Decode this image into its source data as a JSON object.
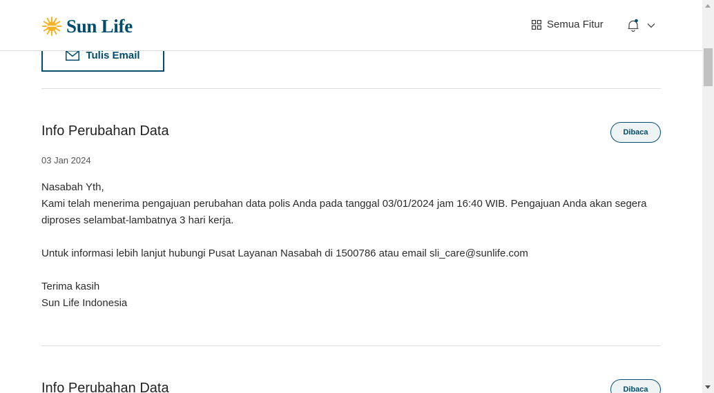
{
  "header": {
    "brand": "Sun Life",
    "features_label": "Semua Fitur",
    "icons": {
      "logo": "sun-logo",
      "features": "grid-icon",
      "notifications": "bell-icon",
      "menu": "chevron-down-icon"
    },
    "colors": {
      "brand": "#004c6c",
      "logo_sun": "#f5b324"
    }
  },
  "actions": {
    "write_email_label": "Tulis Email",
    "write_email_icon": "mail-icon"
  },
  "messages": [
    {
      "title": "Info Perubahan Data",
      "status": "Dibaca",
      "date": "03 Jan 2024",
      "greeting": "Nasabah Yth,",
      "body_line1": "Kami telah menerima pengajuan perubahan data polis Anda pada tanggal 03/01/2024 jam 16:40 WIB. Pengajuan Anda akan segera diproses selambat-lambatnya 3 hari kerja.",
      "body_line2": "Untuk informasi lebih lanjut hubungi Pusat Layanan Nasabah di 1500786 atau email sli_care@sunlife.com",
      "closing": "Terima kasih",
      "signature": "Sun Life Indonesia"
    },
    {
      "title": "Info Perubahan Data",
      "status": "Dibaca"
    }
  ]
}
